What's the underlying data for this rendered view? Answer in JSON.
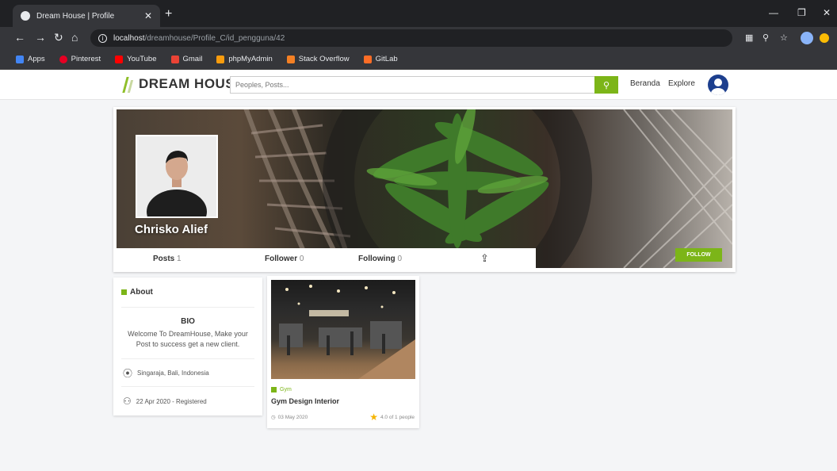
{
  "browser": {
    "tab_title": "Dream House | Profile",
    "url_host": "localhost",
    "url_path": "/dreamhouse/Profile_C/id_pengguna/42",
    "bookmarks": [
      {
        "label": "Apps",
        "color": "#4285f4"
      },
      {
        "label": "Pinterest",
        "color": "#e60023"
      },
      {
        "label": "YouTube",
        "color": "#ff0000"
      },
      {
        "label": "Gmail",
        "color": "#ea4335"
      },
      {
        "label": "phpMyAdmin",
        "color": "#f89c0e"
      },
      {
        "label": "Stack Overflow",
        "color": "#f48024"
      },
      {
        "label": "GitLab",
        "color": "#fc6d26"
      }
    ]
  },
  "header": {
    "logo": "DREAM HOUSE",
    "search_placeholder": "Peoples, Posts...",
    "nav": [
      "Beranda",
      "Explore"
    ]
  },
  "profile": {
    "name": "Chrisko Alief",
    "stats": [
      {
        "label": "Posts",
        "count": "1"
      },
      {
        "label": "Follower",
        "count": "0"
      },
      {
        "label": "Following",
        "count": "0"
      }
    ],
    "follow_label": "FOLLOW"
  },
  "about": {
    "title": "About",
    "bio_title": "BIO",
    "bio_text": "Welcome To DreamHouse, Make your Post to success get a new client.",
    "location": "Singaraja, Bali, Indonesia",
    "registered": "22 Apr 2020 - Registered"
  },
  "post": {
    "category": "Gym",
    "title": "Gym Design Interior",
    "date": "03 May 2020",
    "rating": "4.0 of 1 people"
  },
  "colors": {
    "accent": "#7cb518",
    "avatar": "#1d3f8e"
  }
}
